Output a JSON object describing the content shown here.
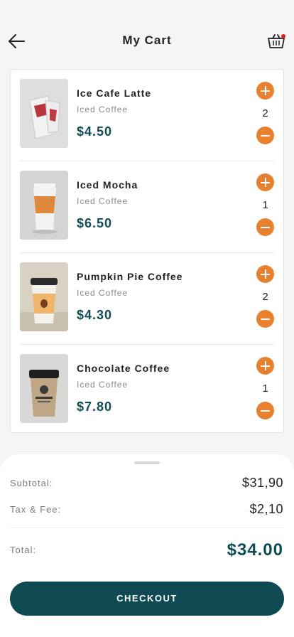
{
  "header": {
    "title": "My Cart",
    "back_icon": "arrow-left-icon",
    "cart_icon": "basket-icon",
    "notification_color": "#e02020"
  },
  "cart": {
    "items": [
      {
        "name": "Ice Cafe Latte",
        "category": "Iced Coffee",
        "price": "$4.50",
        "quantity": "2",
        "image": "iced-latte-cup-image"
      },
      {
        "name": "Iced Mocha",
        "category": "Iced Coffee",
        "price": "$6.50",
        "quantity": "1",
        "image": "orange-coffee-cup-image"
      },
      {
        "name": "Pumpkin Pie Coffee",
        "category": "Iced Coffee",
        "price": "$4.30",
        "quantity": "2",
        "image": "white-coffee-cup-image"
      },
      {
        "name": "Chocolate Coffee",
        "category": "Iced Coffee",
        "price": "$7.80",
        "quantity": "1",
        "image": "kraft-coffee-cup-image"
      }
    ]
  },
  "summary": {
    "subtotal_label": "Subtotal:",
    "subtotal_value": "$31,90",
    "tax_label": "Tax & Fee:",
    "tax_value": "$2,10",
    "total_label": "Total:",
    "total_value": "$34.00",
    "checkout_label": "CHECKOUT"
  },
  "colors": {
    "accent": "#e8802e",
    "primary": "#0f4a52",
    "price": "#0f4d55"
  }
}
